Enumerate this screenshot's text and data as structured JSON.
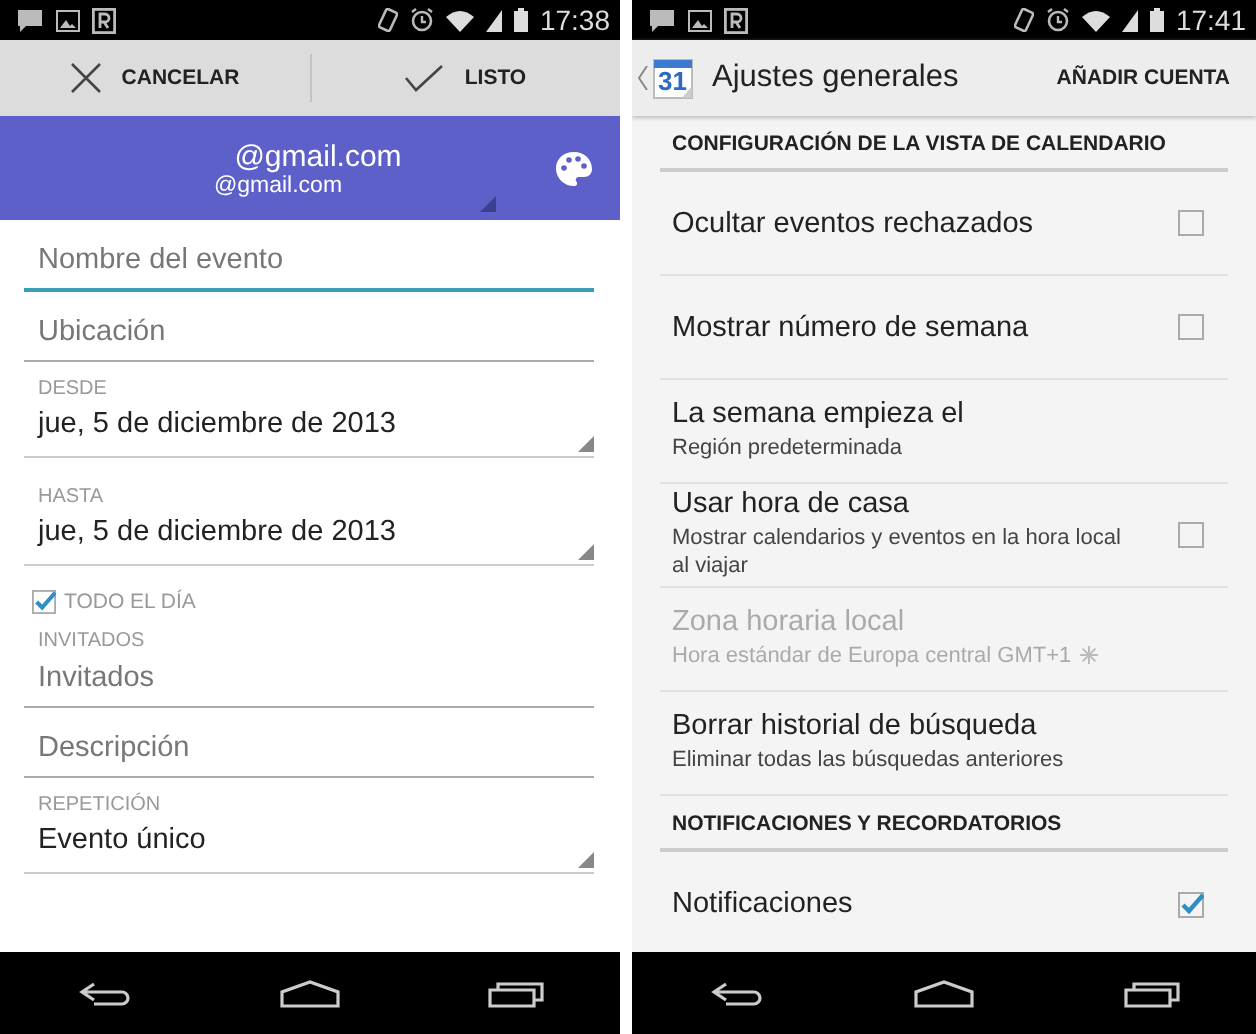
{
  "event_editor": {
    "status_bar": {
      "time": "17:38"
    },
    "action_bar": [
      {
        "kind": "cancel",
        "label": "CANCELAR"
      },
      {
        "kind": "done",
        "label": "LISTO"
      }
    ],
    "account": {
      "name": "@gmail.com",
      "email": "@gmail.com"
    },
    "fields": [
      {
        "kind": "input",
        "placeholder": "Nombre del evento",
        "focused": true
      },
      {
        "kind": "input",
        "placeholder": "Ubicación",
        "focused": false
      },
      {
        "kind": "dropdown",
        "label": "DESDE",
        "value": "jue, 5 de diciembre de 2013"
      },
      {
        "kind": "dropdown",
        "label": "HASTA",
        "value": "jue, 5 de diciembre de 2013"
      },
      {
        "kind": "checkbox",
        "label": "TODO EL DÍA",
        "checked": true
      },
      {
        "kind": "input",
        "label": "INVITADOS",
        "placeholder": "Invitados",
        "focused": false
      },
      {
        "kind": "input",
        "placeholder": "Descripción",
        "focused": false
      },
      {
        "kind": "dropdown",
        "label": "REPETICIÓN",
        "value": "Evento único"
      }
    ]
  },
  "settings": {
    "status_bar": {
      "time": "17:41"
    },
    "app_icon_day": "31",
    "title": "Ajustes generales",
    "action": "AÑADIR CUENTA",
    "items": [
      {
        "kind": "header",
        "title": "CONFIGURACIÓN DE LA VISTA DE CALENDARIO"
      },
      {
        "kind": "checkbox",
        "title": "Ocultar eventos rechazados",
        "checked": false,
        "disabled": false
      },
      {
        "kind": "checkbox",
        "title": "Mostrar número de semana",
        "checked": false,
        "disabled": false
      },
      {
        "kind": "plain",
        "title": "La semana empieza el",
        "summary": "Región predeterminada",
        "disabled": false
      },
      {
        "kind": "checkbox",
        "title": "Usar hora de casa",
        "summary": "Mostrar calendarios y eventos en la hora local al viajar",
        "checked": false,
        "disabled": false
      },
      {
        "kind": "timezone",
        "title": "Zona horaria local",
        "summary": "Hora estándar de Europa central  GMT+1",
        "disabled": true
      },
      {
        "kind": "plain",
        "title": "Borrar historial de búsqueda",
        "summary": "Eliminar todas las búsquedas anteriores",
        "disabled": false
      },
      {
        "kind": "header",
        "title": "NOTIFICACIONES Y RECORDATORIOS"
      },
      {
        "kind": "checkbox",
        "title": "Notificaciones",
        "checked": true,
        "disabled": false
      }
    ]
  }
}
